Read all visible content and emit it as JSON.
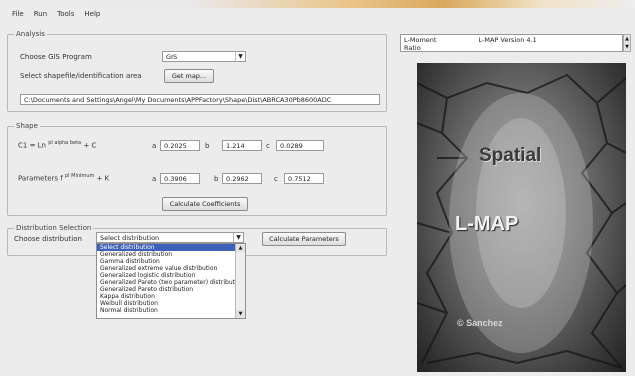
{
  "menu": [
    "File",
    "Run",
    "Tools",
    "Help"
  ],
  "analysis": {
    "legend": "Analysis",
    "choose_label": "Choose GIS Program",
    "choose_value": "GIS",
    "shapefile_label": "Select shapefile/identification area",
    "browse_label": "Get map...",
    "path_value": "C:\\Documents and Settings\\Angel\\My Documents\\APPFactory\\Shape\\Dist\\ABRCA30Pb8600ADC"
  },
  "shape": {
    "legend": "Shape",
    "row1_label": "C1 = Ln",
    "row1_sup": "pl alpha beta",
    "row1_suffix": "+ C",
    "row2_label": "Parameters f",
    "row2_sup": "pl Minimum",
    "row2_suffix": "+ K",
    "row1": {
      "a": "0.2025",
      "b": "1.214",
      "c": "0.0289"
    },
    "row2": {
      "a": "0.3906",
      "b": "0.2962",
      "c": "0.7512"
    },
    "compute_label": "Calculate Coefficients"
  },
  "distribution": {
    "legend": "Distribution Selection",
    "choose_label": "Choose distribution",
    "selected": "Select distribution",
    "get_params_label": "Calculate Parameters",
    "options": [
      "Select distribution",
      "Generalized distribution",
      "Gamma distribution",
      "Generalized extreme value distribution",
      "Generalized logistic distribution",
      "Generalized Pareto (two parameter) distribution",
      "Generalized Pareto distribution",
      "Kappa distribution",
      "Weibull distribution",
      "Normal distribution"
    ]
  },
  "info": {
    "label": "L-Moment",
    "label2": "Ratio",
    "value": "L-MAP Version 4.1"
  },
  "poster": {
    "title": "Spatial",
    "subtitle": "L-MAP",
    "credit": "© Sanchez"
  }
}
